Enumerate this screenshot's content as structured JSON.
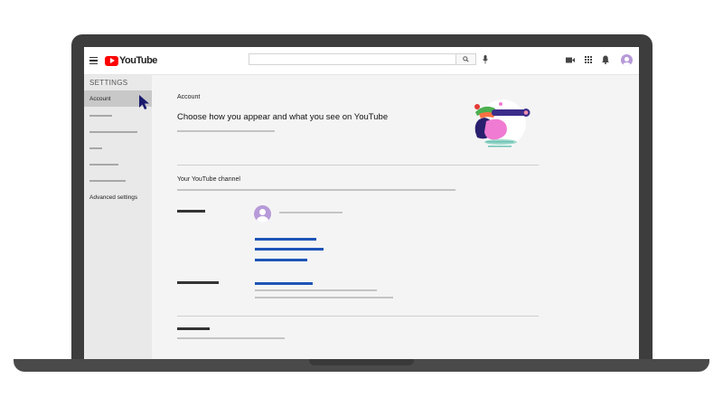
{
  "app": {
    "logo_text": "YouTube"
  },
  "topbar": {
    "icons": [
      "menu-icon",
      "search-icon",
      "mic-icon",
      "video-camera-icon",
      "apps-grid-icon",
      "bell-icon",
      "avatar-icon"
    ]
  },
  "sidebar": {
    "title": "SETTINGS",
    "items": [
      {
        "label": "Account",
        "active": true
      },
      {
        "label": ""
      },
      {
        "label": ""
      },
      {
        "label": ""
      },
      {
        "label": ""
      },
      {
        "label": ""
      },
      {
        "label": "Advanced settings"
      }
    ]
  },
  "main": {
    "section_label": "Account",
    "title": "Choose how you appear and what you see on YouTube",
    "channel_heading": "Your YouTube channel"
  },
  "colors": {
    "brand_red": "#ff0000",
    "link_blue": "#1e54b7",
    "avatar_purple": "#b79ad8",
    "cursor_navy": "#1a1a6e"
  }
}
